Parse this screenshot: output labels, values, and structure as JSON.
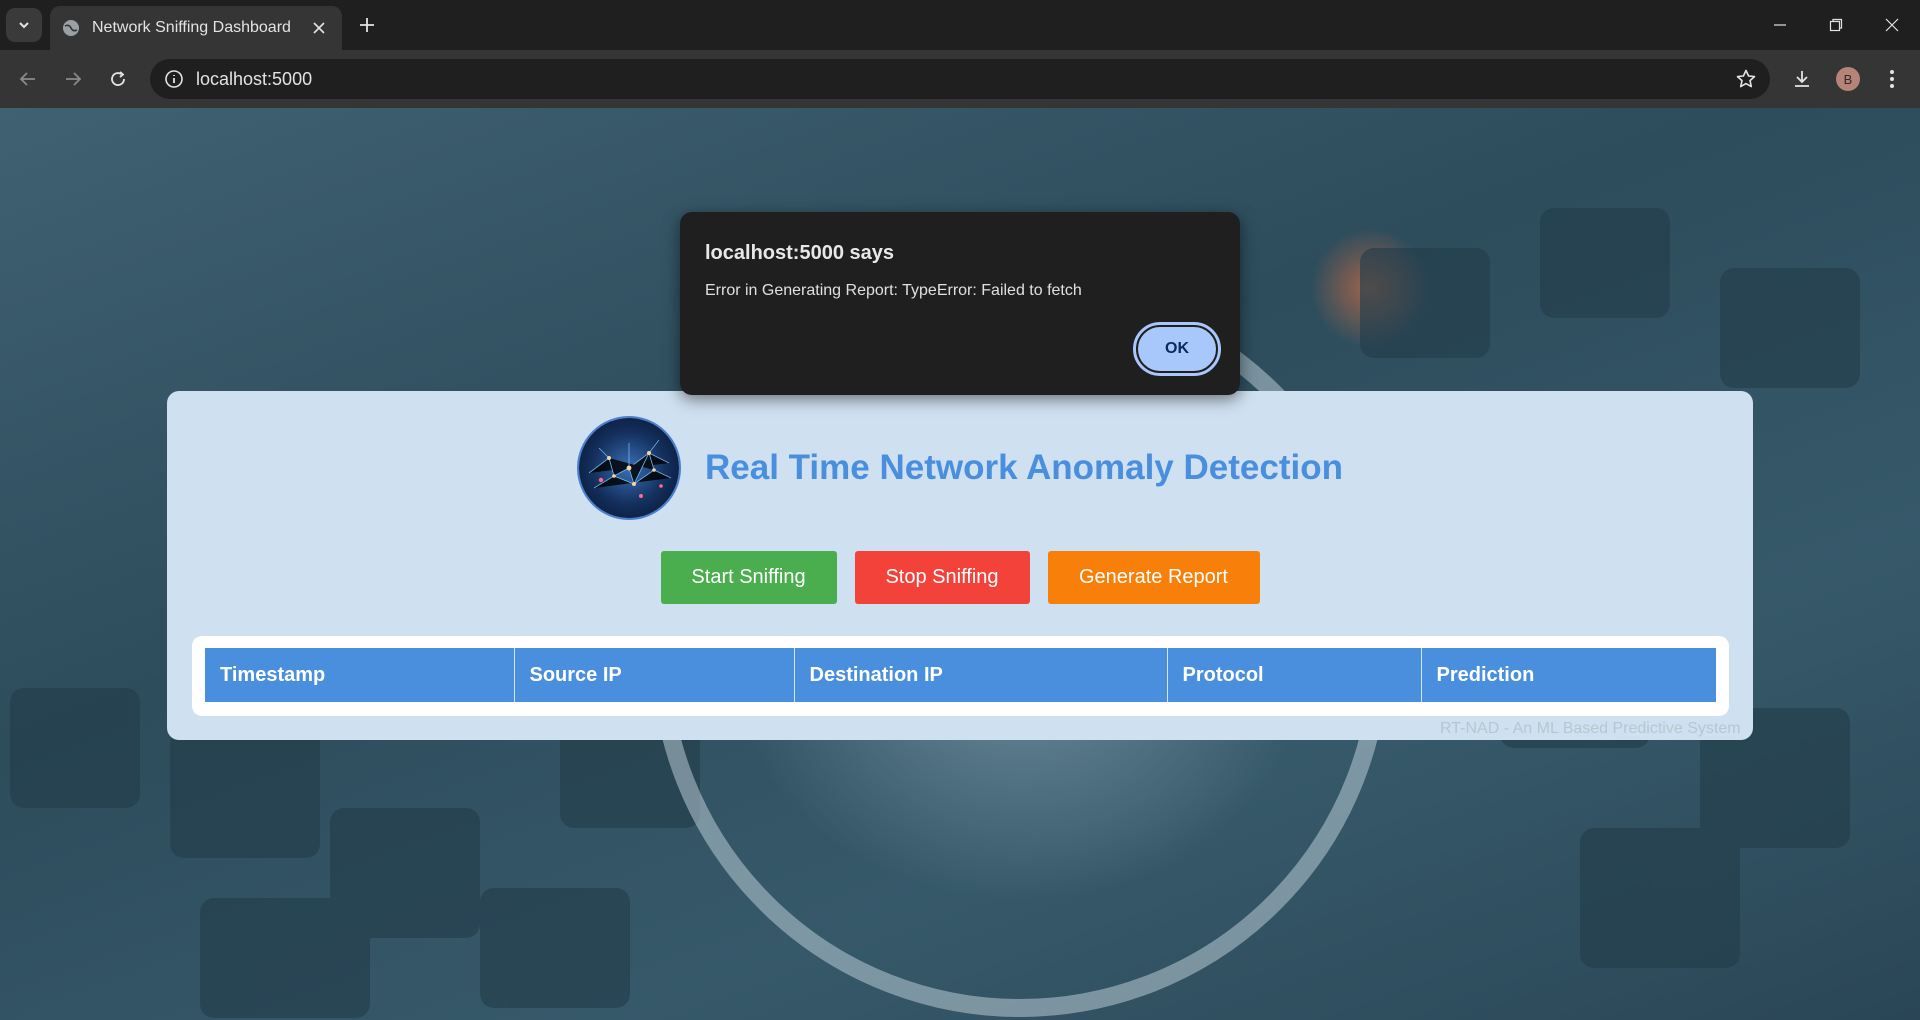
{
  "browser": {
    "tab_title": "Network Sniffing Dashboard",
    "url": "localhost:5000",
    "profile_initial": "B"
  },
  "page": {
    "title": "Real Time Network Anomaly Detection",
    "buttons": {
      "start": "Start Sniffing",
      "stop": "Stop Sniffing",
      "report": "Generate Report"
    },
    "table": {
      "headers": [
        "Timestamp",
        "Source IP",
        "Destination IP",
        "Protocol",
        "Prediction"
      ],
      "rows": []
    },
    "footer": "RT-NAD - An ML Based Predictive System"
  },
  "dialog": {
    "title": "localhost:5000 says",
    "message": "Error in Generating Report: TypeError: Failed to fetch",
    "ok_label": "OK"
  },
  "colors": {
    "start": "#4aad4e",
    "stop": "#f2423a",
    "report": "#f77f0a",
    "header_accent": "#4a8fde"
  },
  "icons": {
    "tab_list": "chevron-down-icon",
    "tab_favicon": "globe-icon",
    "tab_close": "close-icon",
    "new_tab": "plus-icon",
    "back": "arrow-left-icon",
    "forward": "arrow-right-icon",
    "reload": "reload-icon",
    "site_info": "info-icon",
    "bookmark": "star-icon",
    "downloads": "download-icon",
    "menu": "kebab-menu-icon"
  }
}
